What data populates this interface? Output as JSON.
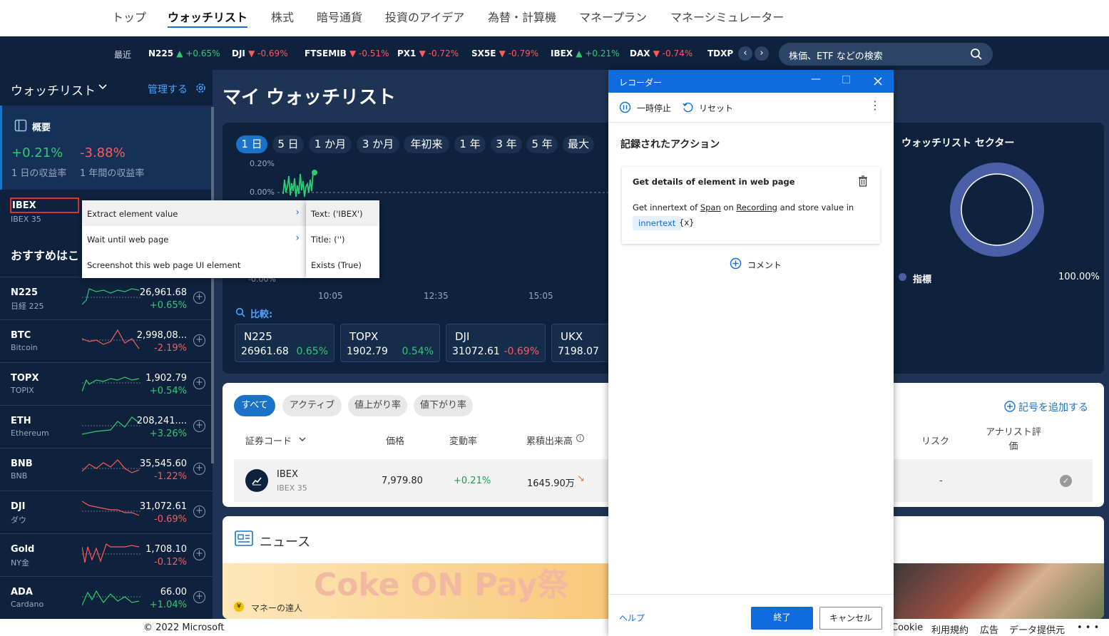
{
  "nav": {
    "items": [
      "トップ",
      "ウォッチリスト",
      "株式",
      "暗号通貨",
      "投資のアイデア",
      "為替・計算機",
      "マネープラン",
      "マネーシミュレーター"
    ]
  },
  "ticker": {
    "recent_label": "最近",
    "items": [
      {
        "sym": "N225",
        "arrow": "▲",
        "chg": "+0.65%",
        "dir": "up"
      },
      {
        "sym": "DJI",
        "arrow": "▼",
        "chg": "-0.69%",
        "dir": "dn"
      },
      {
        "sym": "FTSEMIB",
        "arrow": "▼",
        "chg": "-0.51%",
        "dir": "dn"
      },
      {
        "sym": "PX1",
        "arrow": "▼",
        "chg": "-0.72%",
        "dir": "dn"
      },
      {
        "sym": "SX5E",
        "arrow": "▼",
        "chg": "-0.79%",
        "dir": "dn"
      },
      {
        "sym": "IBEX",
        "arrow": "▲",
        "chg": "+0.21%",
        "dir": "up"
      },
      {
        "sym": "DAX",
        "arrow": "▼",
        "chg": "-0.74%",
        "dir": "dn"
      },
      {
        "sym": "TDXP",
        "arrow": "",
        "chg": "",
        "dir": "up"
      }
    ],
    "search_placeholder": "株価、ETF などの検索"
  },
  "sidebar": {
    "title": "ウォッチリスト",
    "manage": "管理する",
    "summary_label": "概要",
    "day_return": "+0.21%",
    "year_return": "-3.88%",
    "day_return_label": "1 日の収益率",
    "year_return_label": "1 年間の収益率",
    "held": {
      "sym": "IBEX",
      "name": "IBEX 35"
    },
    "recommend_title": "おすすめはこ",
    "rows": [
      {
        "sym": "N225",
        "name": "日経 225",
        "price": "26,961.68",
        "chg": "+0.65%",
        "dir": "up"
      },
      {
        "sym": "BTC",
        "name": "Bitcoin",
        "price": "2,998,08...",
        "chg": "-2.19%",
        "dir": "dn"
      },
      {
        "sym": "TOPX",
        "name": "TOPIX",
        "price": "1,902.79",
        "chg": "+0.54%",
        "dir": "up"
      },
      {
        "sym": "ETH",
        "name": "Ethereum",
        "price": "208,241....",
        "chg": "+3.26%",
        "dir": "up"
      },
      {
        "sym": "BNB",
        "name": "BNB",
        "price": "35,545.60",
        "chg": "-1.22%",
        "dir": "dn"
      },
      {
        "sym": "DJI",
        "name": "ダウ",
        "price": "31,072.61",
        "chg": "-0.69%",
        "dir": "dn"
      },
      {
        "sym": "Gold",
        "name": "NY金",
        "price": "1,708.10",
        "chg": "-0.12%",
        "dir": "dn"
      },
      {
        "sym": "ADA",
        "name": "Cardano",
        "price": "66.00",
        "chg": "+1.04%",
        "dir": "up"
      }
    ]
  },
  "main": {
    "title": "マイ ウォッチリスト",
    "ranges": [
      "1 日",
      "5 日",
      "1 か月",
      "3 か月",
      "年初来",
      "1 年",
      "3 年",
      "5 年",
      "最大"
    ],
    "y_labels": [
      "0.20%",
      "0.00%",
      "-0.00%"
    ],
    "x_labels": [
      "10:05",
      "12:35",
      "15:05"
    ],
    "compare_label": "比較:",
    "compare": [
      {
        "sym": "N225",
        "price": "26961.68",
        "chg": "0.65%",
        "dir": "up"
      },
      {
        "sym": "TOPX",
        "price": "1902.79",
        "chg": "0.54%",
        "dir": "up"
      },
      {
        "sym": "DJI",
        "price": "31072.61",
        "chg": "-0.69%",
        "dir": "dn"
      },
      {
        "sym": "UKX",
        "price": "7198.07",
        "chg": "",
        "dir": "up"
      }
    ],
    "sector_title": "ウォッチリスト セクター",
    "sector_legend": "指標",
    "sector_value": "100.00%",
    "filters": [
      "すべて",
      "アクティブ",
      "値上がり率",
      "値下がり率"
    ],
    "add_symbol": "記号を追加する",
    "headers": {
      "code": "証券コード",
      "price": "価格",
      "change": "変動率",
      "volume": "累積出来高",
      "risk": "リスク",
      "analyst": "アナリスト評価"
    },
    "row": {
      "sym": "IBEX",
      "name": "IBEX 35",
      "price": "7,979.80",
      "chg": "+0.21%",
      "volume": "1645.90万",
      "risk": "-"
    },
    "news_title": "ニュース",
    "news_banner": "Coke ON Pay祭",
    "news_source": "マネーの達人"
  },
  "footer": {
    "copyright": "© 2022 Microsoft",
    "links": [
      "Cookie",
      "利用規約",
      "広告",
      "データ提供元",
      "• • •"
    ]
  },
  "context_menu": {
    "items": [
      "Extract element value",
      "Wait until web page",
      "Screenshot this web page UI element"
    ],
    "submenu": [
      "Text:  ('IBEX')",
      "Title:  ('')",
      "Exists (True)"
    ]
  },
  "recorder": {
    "title": "レコーダー",
    "pause": "一時停止",
    "reset": "リセット",
    "heading": "記録されたアクション",
    "action_title": "Get details of element in web page",
    "action_text": {
      "p1": "Get innertext of",
      "w1": "Span",
      "p2": "on",
      "w2": "Recording",
      "p3": "and store value in",
      "var": "innertext",
      "vx": "{x}"
    },
    "comment": "コメント",
    "help": "ヘルプ",
    "finish": "終了",
    "cancel": "キャンセル"
  },
  "colors": {
    "accent": "#1a73c8",
    "up": "#2ecc71",
    "down": "#ff5a5a",
    "bg": "#1f3454",
    "panel": "#0e223d"
  }
}
